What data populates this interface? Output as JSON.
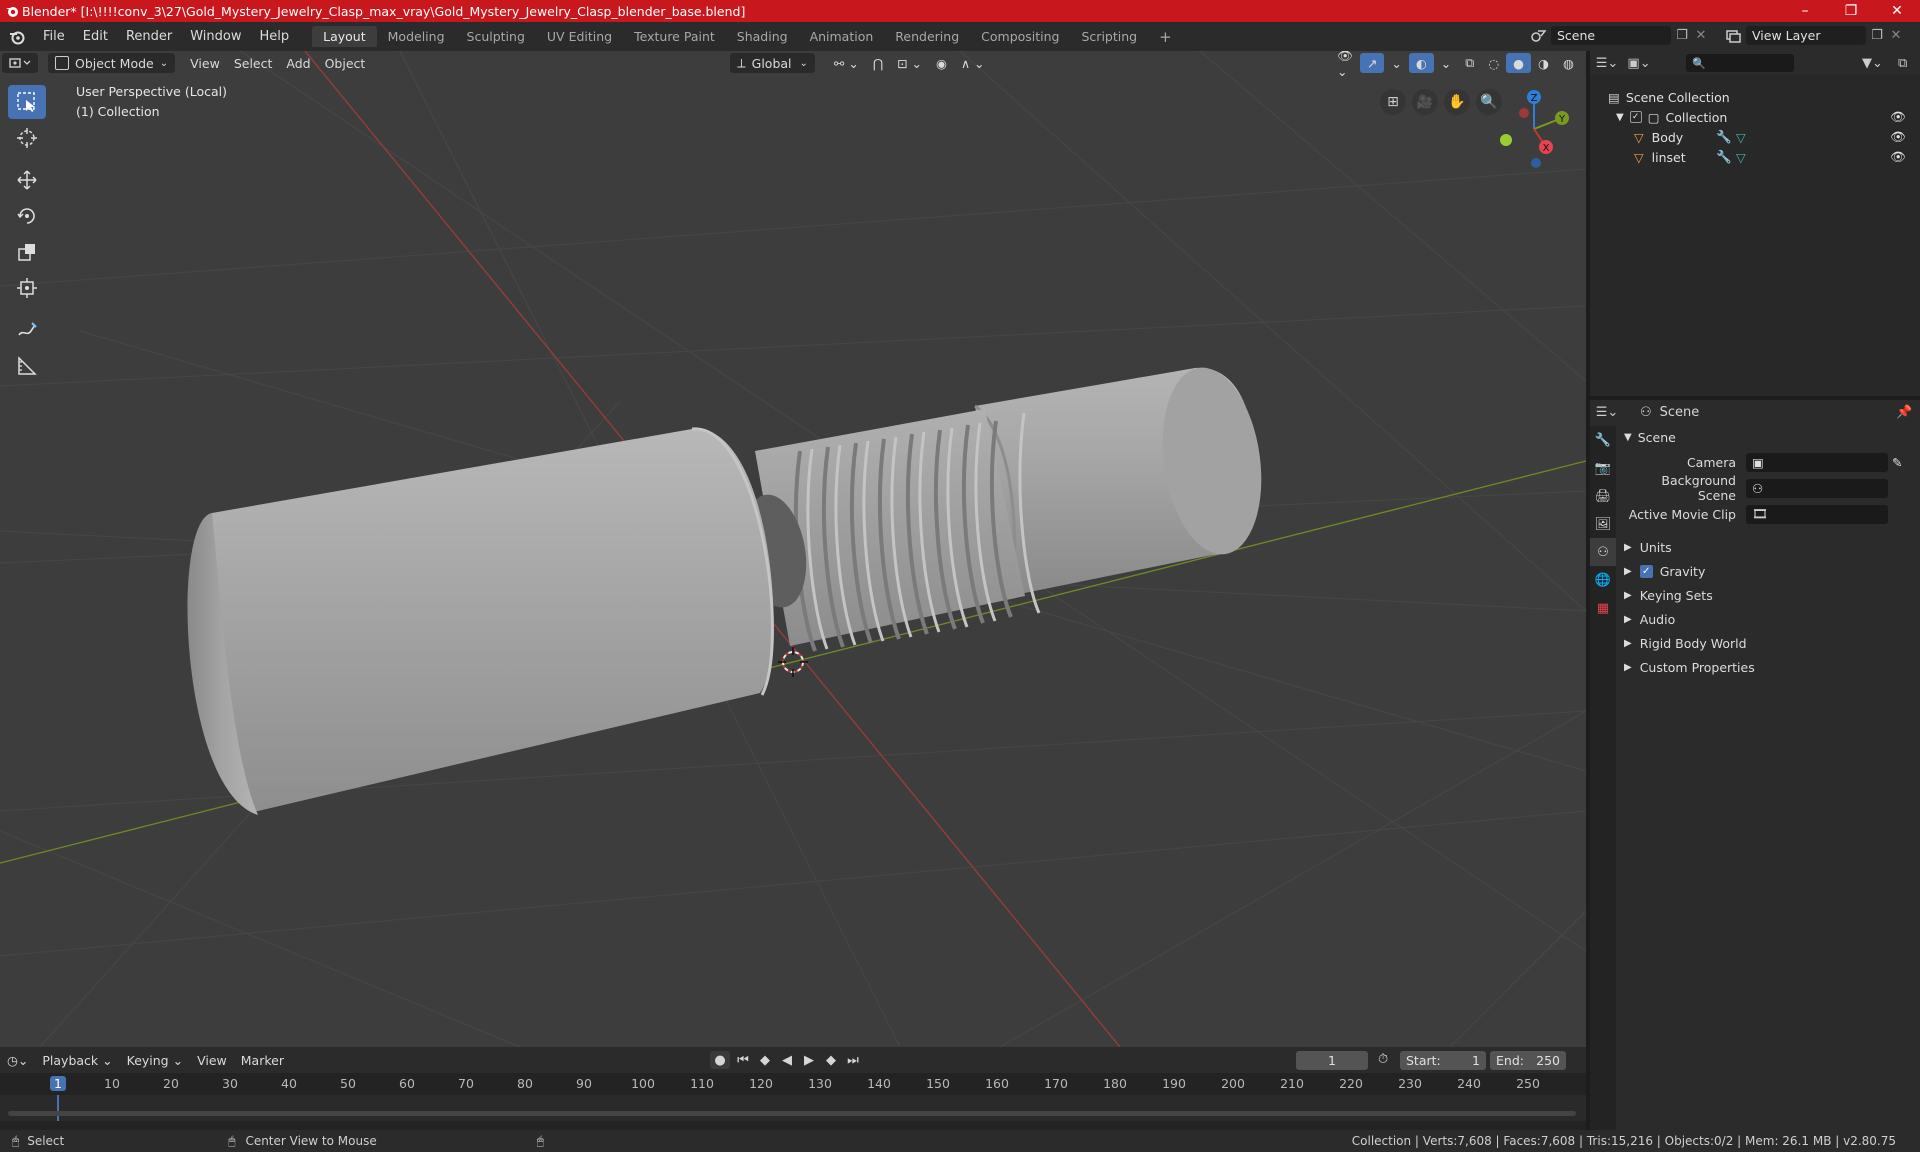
{
  "window": {
    "title": "Blender* [I:\\!!!!conv_3\\27\\Gold_Mystery_Jewelry_Clasp_max_vray\\Gold_Mystery_Jewelry_Clasp_blender_base.blend]",
    "controls": [
      "–",
      "❐",
      "✕"
    ]
  },
  "menu": {
    "items": [
      "File",
      "Edit",
      "Render",
      "Window",
      "Help"
    ],
    "workspaces": [
      "Layout",
      "Modeling",
      "Sculpting",
      "UV Editing",
      "Texture Paint",
      "Shading",
      "Animation",
      "Rendering",
      "Compositing",
      "Scripting"
    ],
    "active_workspace": "Layout",
    "add_tab": "+",
    "scene": "Scene",
    "view_layer": "View Layer"
  },
  "viewport": {
    "mode": "Object Mode",
    "menus": [
      "View",
      "Select",
      "Add",
      "Object"
    ],
    "transform_orientation": "Global",
    "perspective_label": "User Perspective (Local)",
    "collection_label": "(1) Collection",
    "gizmo_axes": {
      "x": "X",
      "y": "Y",
      "z": "Z"
    }
  },
  "outliner": {
    "root": "Scene Collection",
    "collection": "Collection",
    "objects": [
      "Body",
      "linset"
    ],
    "search_placeholder": ""
  },
  "properties": {
    "header": "Scene",
    "panel": "Scene",
    "fields": [
      {
        "label": "Camera",
        "value": ""
      },
      {
        "label": "Background Scene",
        "value": ""
      },
      {
        "label": "Active Movie Clip",
        "value": ""
      }
    ],
    "sections": [
      "Units",
      "Gravity",
      "Keying Sets",
      "Audio",
      "Rigid Body World",
      "Custom Properties"
    ],
    "gravity_checked": true
  },
  "timeline": {
    "menus": [
      "Playback",
      "Keying",
      "View",
      "Marker"
    ],
    "current_frame": "1",
    "start_label": "Start:",
    "start": "1",
    "end_label": "End:",
    "end": "250",
    "ruler": [
      "1",
      "10",
      "20",
      "30",
      "40",
      "50",
      "60",
      "70",
      "80",
      "90",
      "100",
      "110",
      "120",
      "130",
      "140",
      "150",
      "160",
      "170",
      "180",
      "190",
      "200",
      "210",
      "220",
      "230",
      "240",
      "250"
    ]
  },
  "status": {
    "select": "Select",
    "center_view": "Center View to Mouse",
    "stats": "Collection | Verts:7,608 | Faces:7,608 | Tris:15,216 | Objects:0/2 | Mem: 26.1 MB | v2.80.75"
  },
  "colors": {
    "titlebar": "#c8181d",
    "accent": "#4772b3",
    "x_axis": "#c0392b",
    "y_axis": "#7a9a1e",
    "z_axis": "#2f7fd9"
  }
}
